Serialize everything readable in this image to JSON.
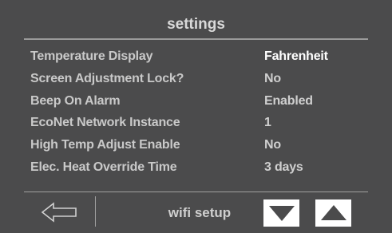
{
  "header": {
    "title": "settings"
  },
  "settings": [
    {
      "label": "Temperature Display",
      "value": "Fahrenheit"
    },
    {
      "label": "Screen Adjustment Lock?",
      "value": "No"
    },
    {
      "label": "Beep On Alarm",
      "value": "Enabled"
    },
    {
      "label": "EcoNet Network Instance",
      "value": "1"
    },
    {
      "label": "High Temp Adjust Enable",
      "value": "No"
    },
    {
      "label": "Elec. Heat Override Time",
      "value": "3 days"
    }
  ],
  "footer": {
    "back_icon": "left-arrow-outline-icon",
    "wifi_label": "wifi setup",
    "down_icon": "triangle-down-icon",
    "up_icon": "triangle-up-icon"
  },
  "colors": {
    "background": "#4b4b4c",
    "text": "#cfcfcf",
    "highlight_value": "#ffffff",
    "button_fill": "#ffffff",
    "arrow_fill": "#4b4b4c"
  }
}
